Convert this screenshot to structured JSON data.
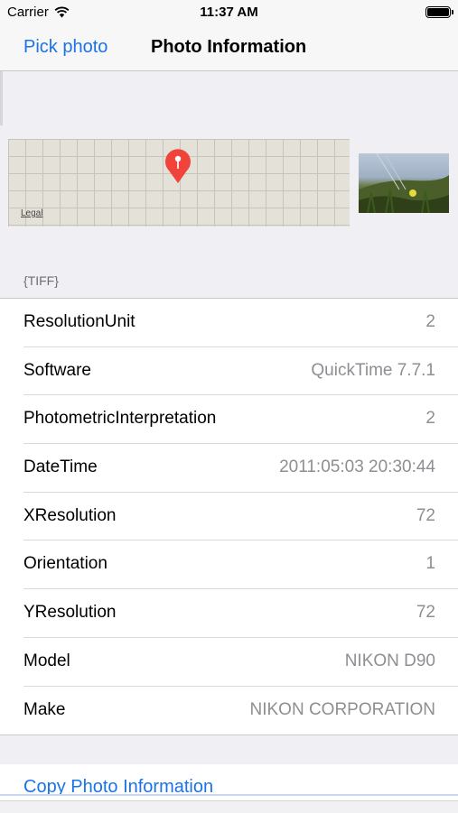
{
  "status_bar": {
    "carrier": "Carrier",
    "time": "11:37 AM"
  },
  "nav": {
    "back_label": "Pick photo",
    "title": "Photo Information"
  },
  "map": {
    "legal_label": "Legal",
    "pin_color": "#f0443a"
  },
  "section": {
    "label": "{TIFF}"
  },
  "rows": [
    {
      "key": "ResolutionUnit",
      "value": "2"
    },
    {
      "key": "Software",
      "value": "QuickTime 7.7.1"
    },
    {
      "key": "PhotometricInterpretation",
      "value": "2"
    },
    {
      "key": "DateTime",
      "value": "2011:05:03 20:30:44"
    },
    {
      "key": "XResolution",
      "value": "72"
    },
    {
      "key": "Orientation",
      "value": "1"
    },
    {
      "key": "YResolution",
      "value": "72"
    },
    {
      "key": "Model",
      "value": "NIKON D90"
    },
    {
      "key": "Make",
      "value": "NIKON CORPORATION"
    }
  ],
  "copy_button": {
    "label": "Copy Photo Information"
  },
  "colors": {
    "accent": "#1a73e8",
    "background": "#efeff4"
  }
}
